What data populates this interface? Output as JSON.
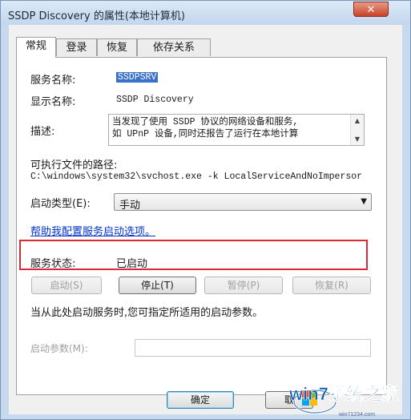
{
  "window": {
    "title": "SSDP Discovery 的属性(本地计算机)",
    "close_glyph": "✕"
  },
  "tabs": [
    {
      "label": "常规",
      "active": true
    },
    {
      "label": "登录",
      "active": false
    },
    {
      "label": "恢复",
      "active": false
    },
    {
      "label": "依存关系",
      "active": false
    }
  ],
  "general": {
    "service_name_label": "服务名称:",
    "service_name_value": "SSDPSRV",
    "display_name_label": "显示名称:",
    "display_name_value": "SSDP Discovery",
    "description_label": "描述:",
    "description_value": "当发现了使用 SSDP 协议的网络设备和服务,\n如 UPnP 设备,同时还报告了运行在本地计算",
    "path_label": "可执行文件的路径:",
    "path_value": "C:\\windows\\system32\\svchost.exe -k LocalServiceAndNoImpersor",
    "startup_type_label": "启动类型(E):",
    "startup_type_value": "手动",
    "help_link": "帮助我配置服务启动选项。",
    "status_label": "服务状态:",
    "status_value": "已启动",
    "start_button": "启动(S)",
    "stop_button": "停止(T)",
    "pause_button": "暂停(P)",
    "resume_button": "恢复(R)",
    "hint_text": "当从此处启动服务时,您可指定所适用的启动参数。",
    "params_label": "启动参数(M):",
    "params_value": ""
  },
  "footer": {
    "ok_button": "确定",
    "cancel_button": "取"
  },
  "watermark": {
    "text": "win7系统之家",
    "site": "win71234.com"
  },
  "colors": {
    "accent": "#3a72c9",
    "highlight_box": "#d92a35",
    "link": "#0033cc"
  }
}
